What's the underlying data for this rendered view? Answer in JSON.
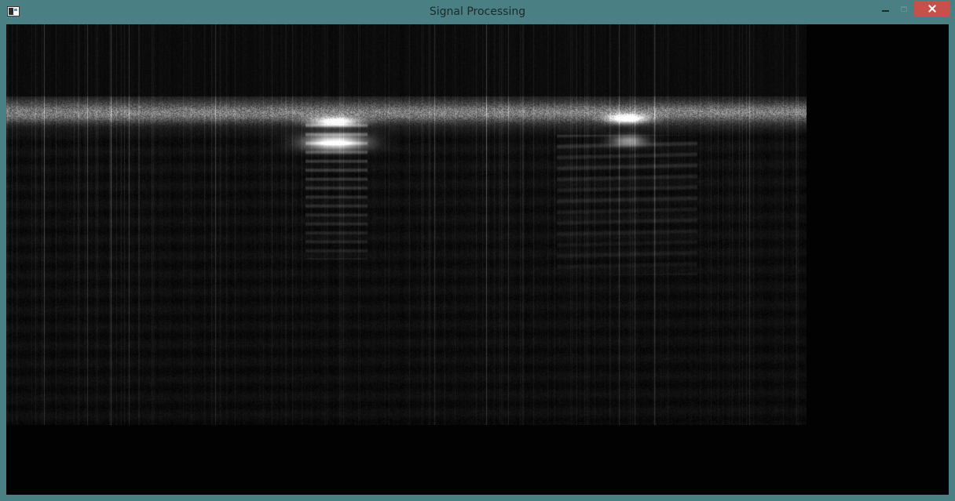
{
  "window": {
    "title": "Signal Processing",
    "controls": {
      "minimize": "minimize",
      "maximize": "maximize",
      "close": "close"
    },
    "colors": {
      "frame": "#4a7f84",
      "close_button": "#c7504b",
      "client_background": "#020202"
    }
  },
  "content": {
    "image_type": "spectrogram",
    "colormap": "grayscale",
    "icon": "app-window-icon"
  }
}
